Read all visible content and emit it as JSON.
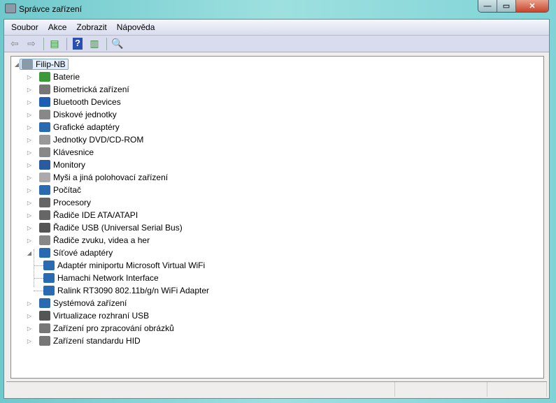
{
  "window": {
    "title": "Správce zařízení"
  },
  "menu": [
    "Soubor",
    "Akce",
    "Zobrazit",
    "Nápověda"
  ],
  "toolbar": [
    "back-icon",
    "forward-icon",
    "show-hide-console-tree-icon",
    "help-icon",
    "show-hide-action-pane-icon",
    "scan-hardware-icon"
  ],
  "tree": {
    "root": "Filip-NB",
    "items": [
      {
        "label": "Baterie",
        "color": "#3a9a3a"
      },
      {
        "label": "Biometrická zařízení",
        "color": "#777777"
      },
      {
        "label": "Bluetooth Devices",
        "color": "#1e5fb4"
      },
      {
        "label": "Diskové jednotky",
        "color": "#888888"
      },
      {
        "label": "Grafické adaptéry",
        "color": "#2a6ab0"
      },
      {
        "label": "Jednotky DVD/CD-ROM",
        "color": "#999999"
      },
      {
        "label": "Klávesnice",
        "color": "#888888"
      },
      {
        "label": "Monitory",
        "color": "#2a5aa0"
      },
      {
        "label": "Myši a jiná polohovací zařízení",
        "color": "#aaaaaa"
      },
      {
        "label": "Počítač",
        "color": "#2a6ab0"
      },
      {
        "label": "Procesory",
        "color": "#666666"
      },
      {
        "label": "Řadiče IDE ATA/ATAPI",
        "color": "#666666"
      },
      {
        "label": "Řadiče USB (Universal Serial Bus)",
        "color": "#555555"
      },
      {
        "label": "Řadiče zvuku, videa a her",
        "color": "#888888"
      },
      {
        "label": "Síťové adaptéry",
        "color": "#2a6ab0",
        "expanded": true,
        "children": [
          "Adaptér miniportu Microsoft Virtual WiFi",
          "Hamachi Network Interface",
          "Ralink RT3090 802.11b/g/n WiFi Adapter"
        ]
      },
      {
        "label": "Systémová zařízení",
        "color": "#2a6ab0"
      },
      {
        "label": "Virtualizace rozhraní USB",
        "color": "#555555"
      },
      {
        "label": "Zařízení pro zpracování obrázků",
        "color": "#777777"
      },
      {
        "label": "Zařízení standardu HID",
        "color": "#777777"
      }
    ]
  }
}
